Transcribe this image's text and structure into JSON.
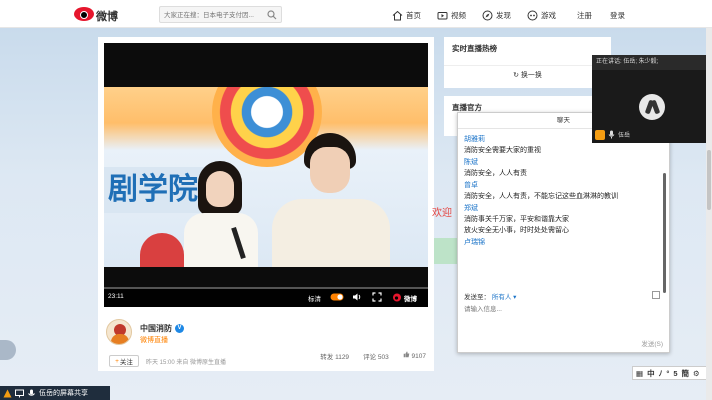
{
  "header": {
    "logo_text": "微博",
    "search_placeholder": "大家正在搜：日本电子支付因...",
    "nav": [
      {
        "label": "首页",
        "icon": "home-icon"
      },
      {
        "label": "视频",
        "icon": "video-icon"
      },
      {
        "label": "发现",
        "icon": "compass-icon"
      },
      {
        "label": "游戏",
        "icon": "game-icon"
      },
      {
        "label": "注册",
        "icon": ""
      },
      {
        "label": "登录",
        "icon": ""
      }
    ]
  },
  "video": {
    "banner_text": "剧学院",
    "time": "23:11",
    "quality_label": "标清",
    "watermark": "微博",
    "progress": 0.0
  },
  "post": {
    "author": "中国消防",
    "subtitle": "微博直播",
    "follow_label": "关注",
    "meta": "昨天 15:00 来自 微博原生直播",
    "stats": {
      "repost": "转发 1129",
      "comment": "评论 503",
      "like": "9107"
    }
  },
  "right_panel": {
    "hot_title": "实时直播热榜",
    "refresh_label": "换一换",
    "official_title": "直播官方",
    "welcome": "欢迎"
  },
  "chat": {
    "title": "聊天",
    "messages": [
      {
        "name": "胡雅莉",
        "text": "消防安全需要大家的重视"
      },
      {
        "name": "陈斌",
        "text": "消防安全，人人有责"
      },
      {
        "name": "曾卓",
        "text": "消防安全，人人有责，不能忘记这些血淋淋的教训"
      },
      {
        "name": "郑斌",
        "text": "消防事关千万家，平安和谐靠大家"
      },
      {
        "name": "",
        "text": "放火安全无小事，时时处处需留心"
      },
      {
        "name": "卢瑞锦",
        "text": ""
      }
    ],
    "send_to_label": "发送至：",
    "send_target": "所有人 ▾",
    "input_placeholder": "请输入信息...",
    "send_button": "发送(S)"
  },
  "speaker": {
    "header": "正在讲话: 伍岳; 朱少毅;",
    "name": "伍岳"
  },
  "ime": {
    "items": [
      "中",
      "ﾉ",
      "°",
      "5",
      "簡",
      "⚙"
    ]
  },
  "share_bar": {
    "label": "伍岳的屏幕共享"
  }
}
